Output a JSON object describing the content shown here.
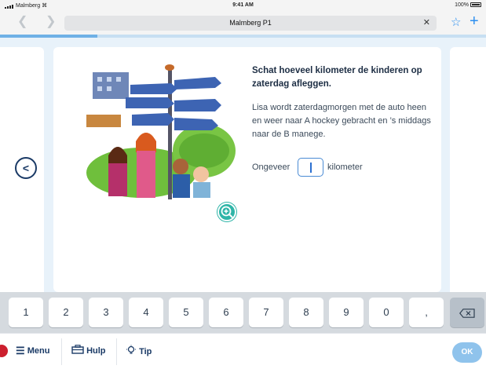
{
  "status_bar": {
    "carrier": "Malmberg",
    "time": "9:41 AM",
    "battery": "100%"
  },
  "browser": {
    "url_title": "Malmberg P1",
    "back_icon": "chevron-left-icon",
    "forward_icon": "chevron-right-icon"
  },
  "progress": {
    "fraction": 0.2
  },
  "exercise": {
    "title": "Schat hoeveel kilometer de kinderen op zaterdag afleggen.",
    "text": "Lisa wordt zaterdagmorgen met de auto heen en weer naar A hockey gebracht en ’s middags naar de B manege.",
    "answer_prefix": "Ongeveer",
    "answer_value": "",
    "answer_suffix": "kilometer"
  },
  "keypad": {
    "keys": [
      "1",
      "2",
      "3",
      "4",
      "5",
      "6",
      "7",
      "8",
      "9",
      "0",
      ","
    ]
  },
  "toolbar": {
    "menu_label": "Menu",
    "help_label": "Hulp",
    "tip_label": "Tip",
    "ok_label": "OK"
  },
  "colors": {
    "accent": "#2c8ff0",
    "navy": "#1a3a66",
    "teal": "#2fb5a8",
    "stage": "#e8f2fa",
    "record_dot": "#cc1f2e"
  }
}
